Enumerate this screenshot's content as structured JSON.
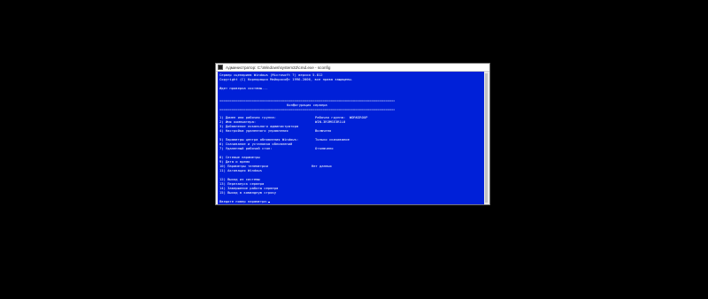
{
  "window": {
    "title": "Администратор: C:\\Windows\\system32\\cmd.exe - sconfig",
    "accent_color": "#0020d8"
  },
  "console": {
    "header_line_1": "Сервер сценариев Windows (Microsoft ?) версия 5.812",
    "header_line_2": "Copyright (C) Корпорация Майкрософт 1996-2006, все права защищены.",
    "check_line": "Идет проверка системы...",
    "separator": "=====================================================================================================",
    "section_title": "Конфигурация сервера",
    "menu": [
      {
        "label": "1) Домен или рабочая группа:",
        "value": "Рабочая группа:  WORKGROUP"
      },
      {
        "label": "2) Имя компьютера:",
        "value": "WIN-3R3MSE3R1L0"
      },
      {
        "label": "3) Добавление локального администратора",
        "value": ""
      },
      {
        "label": "4) Настройка удаленного управления",
        "value": "Включено"
      },
      {
        "label": "5) Параметры центра обновления Windows:",
        "value": "Только скачивание"
      },
      {
        "label": "6) Скачивание и установка обновлений",
        "value": ""
      },
      {
        "label": "7) Удаленный рабочий стол:",
        "value": "Отключено"
      },
      {
        "label": "8) Сетевые параметры",
        "value": ""
      },
      {
        "label": "9) Дата и время",
        "value": ""
      },
      {
        "label": "10) Параметры телеметрии",
        "value": "Нет данных"
      },
      {
        "label": "11) Активация Windows",
        "value": ""
      },
      {
        "label": "12) Выход из системы",
        "value": ""
      },
      {
        "label": "13) Перезапуск сервера",
        "value": ""
      },
      {
        "label": "14) Завершение работы сервера",
        "value": ""
      },
      {
        "label": "15) Выход в командную строку",
        "value": ""
      }
    ],
    "prompt": "Введите номер параметра:"
  }
}
